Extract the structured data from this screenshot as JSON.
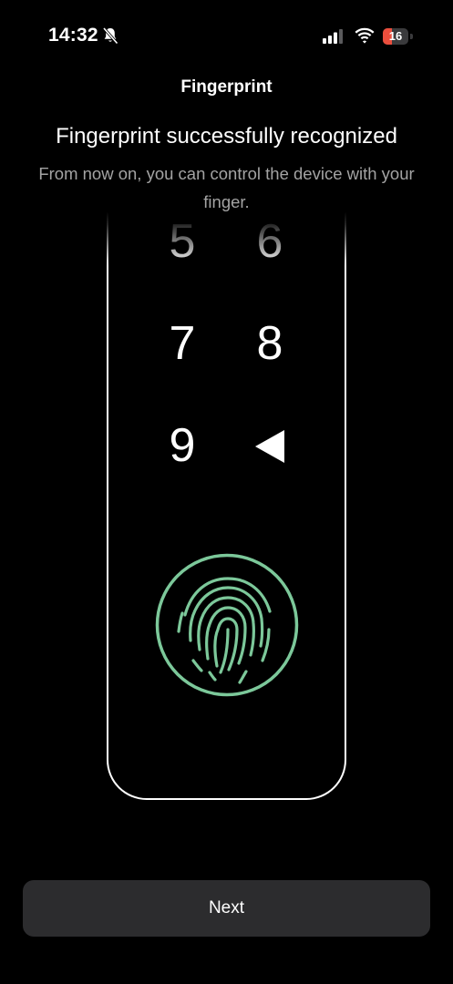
{
  "status_bar": {
    "time": "14:32",
    "battery_level": "16",
    "icons": [
      "bell-slash-icon",
      "cellular-signal-icon",
      "wifi-icon",
      "battery-icon"
    ]
  },
  "nav": {
    "title": "Fingerprint"
  },
  "content": {
    "headline": "Fingerprint successfully recognized",
    "subtitle": "From now on, you can control the device with your finger."
  },
  "keypad": {
    "keys": [
      "5",
      "6",
      "7",
      "8",
      "9"
    ],
    "backspace_icon": "backspace-triangle-icon"
  },
  "sensor": {
    "icon": "fingerprint-icon",
    "accent_color": "#7cc89a"
  },
  "footer": {
    "next_label": "Next"
  },
  "colors": {
    "background": "#000000",
    "button": "#2c2c2e",
    "battery_low": "#eb4e3d"
  }
}
